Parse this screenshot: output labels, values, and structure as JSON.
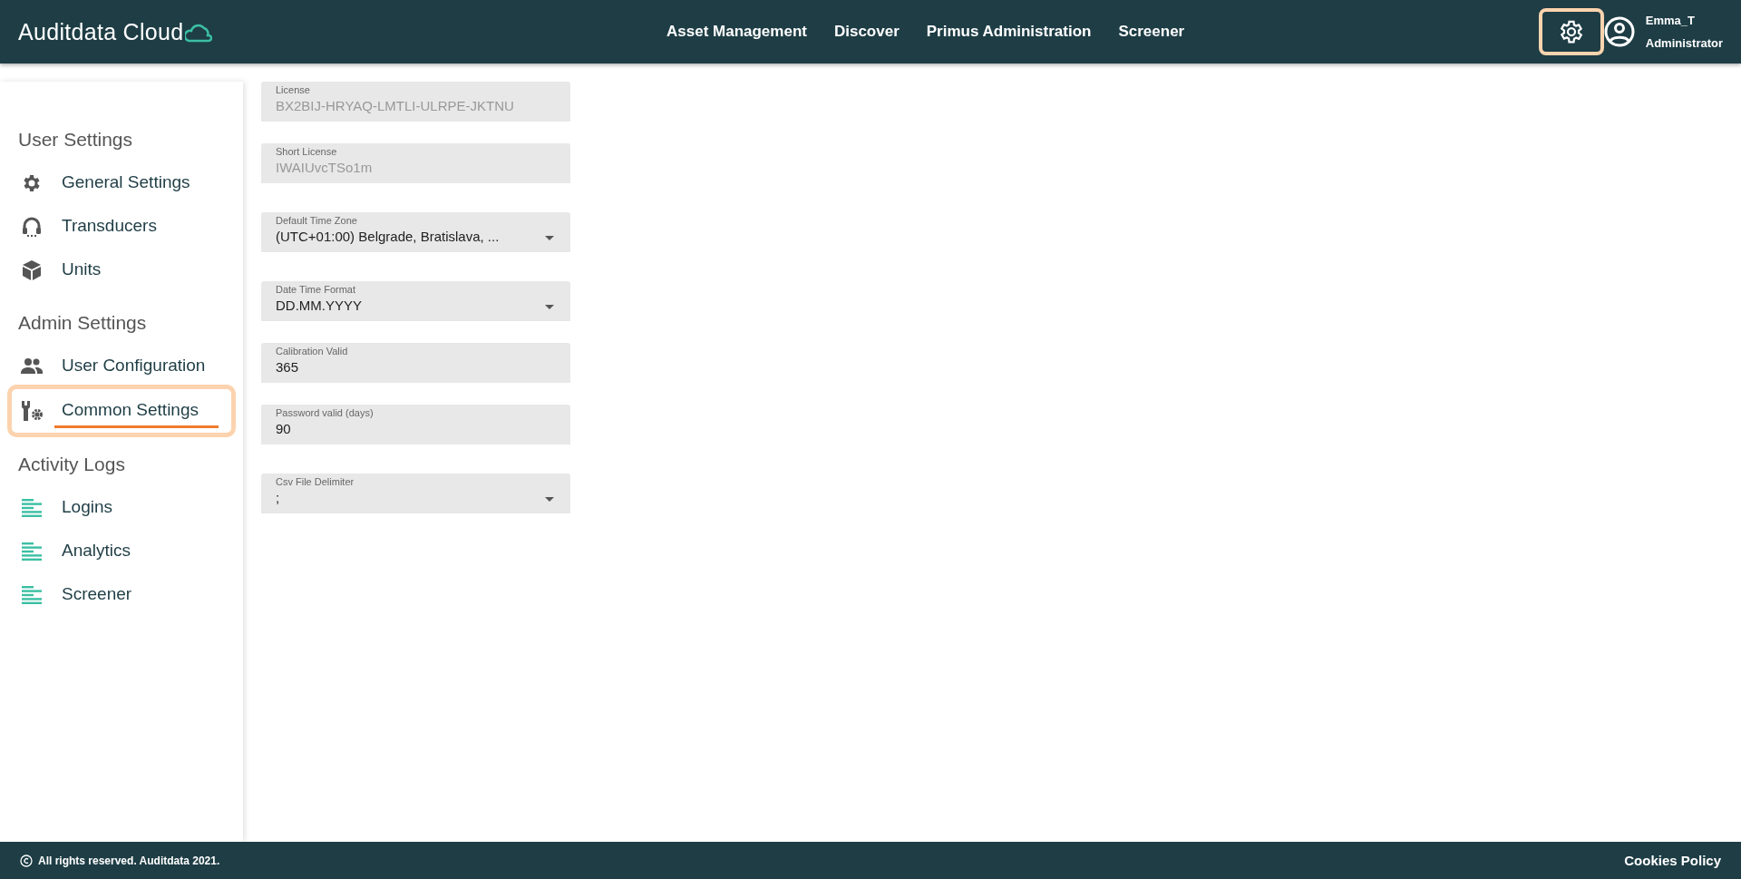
{
  "header": {
    "logo": "Auditdata Cloud",
    "nav": [
      {
        "label": "Asset Management"
      },
      {
        "label": "Discover"
      },
      {
        "label": "Primus Administration"
      },
      {
        "label": "Screener"
      }
    ],
    "settings_button": {
      "highlighted": true
    },
    "user": {
      "name": "Emma_T",
      "role": "Administrator"
    }
  },
  "sidebar": {
    "sections": [
      {
        "title": "User Settings",
        "items": [
          {
            "label": "General Settings",
            "kind": "gear",
            "selected": false,
            "highlighted": false
          },
          {
            "label": "Transducers",
            "kind": "headphones",
            "selected": false,
            "highlighted": false
          },
          {
            "label": "Units",
            "kind": "cube",
            "selected": false,
            "highlighted": false
          }
        ]
      },
      {
        "title": "Admin Settings",
        "items": [
          {
            "label": "User Configuration",
            "kind": "people",
            "selected": false,
            "highlighted": false
          },
          {
            "label": "Common Settings",
            "kind": "tools",
            "selected": true,
            "highlighted": true
          }
        ]
      },
      {
        "title": "Activity Logs",
        "items": [
          {
            "label": "Logins",
            "kind": "log",
            "selected": false,
            "highlighted": false
          },
          {
            "label": "Analytics",
            "kind": "log",
            "selected": false,
            "highlighted": false
          },
          {
            "label": "Screener",
            "kind": "log",
            "selected": false,
            "highlighted": false
          }
        ]
      }
    ]
  },
  "form": {
    "fields": [
      {
        "kind": "text",
        "label": "License",
        "value": "BX2BIJ-HRYAQ-LMTLI-ULRPE-JKTNU",
        "disabled": true
      },
      {
        "kind": "text",
        "label": "Short License",
        "value": "IWAIUvcTSo1m",
        "disabled": true
      },
      {
        "kind": "select",
        "label": "Default Time Zone",
        "value": "(UTC+01:00) Belgrade, Bratislava, ...",
        "disabled": false
      },
      {
        "kind": "select",
        "label": "Date Time Format",
        "value": "DD.MM.YYYY",
        "disabled": false
      },
      {
        "kind": "text",
        "label": "Calibration Valid",
        "value": "365",
        "disabled": false
      },
      {
        "kind": "text",
        "label": "Password valid (days)",
        "value": "90",
        "disabled": false
      },
      {
        "kind": "select",
        "label": "Csv File Delimiter",
        "value": ";",
        "disabled": false
      }
    ]
  },
  "footer": {
    "copyright": "All rights reserved. Auditdata 2021.",
    "link": "Cookies Policy"
  }
}
